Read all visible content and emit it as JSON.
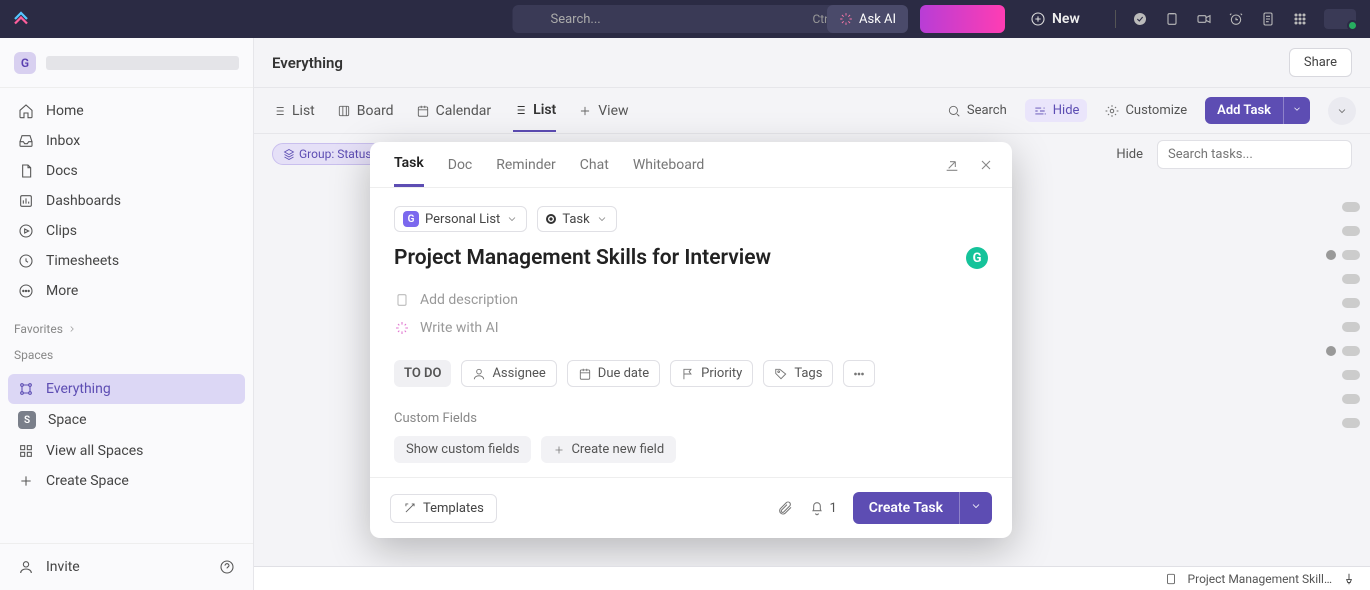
{
  "topbar": {
    "search_placeholder": "Search...",
    "search_shortcut": "Ctrl+K",
    "ask_ai": "Ask AI",
    "new": "New"
  },
  "workspace": {
    "initial": "G"
  },
  "sidebar": {
    "nav": [
      {
        "label": "Home"
      },
      {
        "label": "Inbox"
      },
      {
        "label": "Docs"
      },
      {
        "label": "Dashboards"
      },
      {
        "label": "Clips"
      },
      {
        "label": "Timesheets"
      },
      {
        "label": "More"
      }
    ],
    "favorites_label": "Favorites",
    "spaces_label": "Spaces",
    "spaces": [
      {
        "label": "Everything",
        "active": true
      },
      {
        "label": "Space",
        "initial": "S"
      },
      {
        "label": "View all Spaces"
      },
      {
        "label": "Create Space"
      }
    ],
    "invite": "Invite"
  },
  "main": {
    "title": "Everything",
    "share": "Share",
    "views": [
      {
        "label": "List"
      },
      {
        "label": "Board"
      },
      {
        "label": "Calendar"
      },
      {
        "label": "List",
        "active": true
      },
      {
        "label": "View",
        "add": true
      }
    ],
    "toolbar": {
      "search": "Search",
      "hide": "Hide",
      "customize": "Customize",
      "add_task": "Add Task"
    },
    "filter": {
      "group": "Group: Status",
      "hide": "Hide",
      "search_placeholder": "Search tasks..."
    }
  },
  "modal": {
    "tabs": [
      "Task",
      "Doc",
      "Reminder",
      "Chat",
      "Whiteboard"
    ],
    "active_tab": "Task",
    "location": {
      "list": "Personal List",
      "type": "Task",
      "initial": "G"
    },
    "title": "Project Management Skills for Interview",
    "add_description": "Add description",
    "write_ai": "Write with AI",
    "chips": {
      "todo": "TO DO",
      "assignee": "Assignee",
      "due": "Due date",
      "priority": "Priority",
      "tags": "Tags"
    },
    "custom_fields_label": "Custom Fields",
    "show_cf": "Show custom fields",
    "create_cf": "Create new field",
    "templates": "Templates",
    "bell_count": "1",
    "create": "Create Task"
  },
  "bottombar": {
    "draft": "Project Management Skill…"
  }
}
